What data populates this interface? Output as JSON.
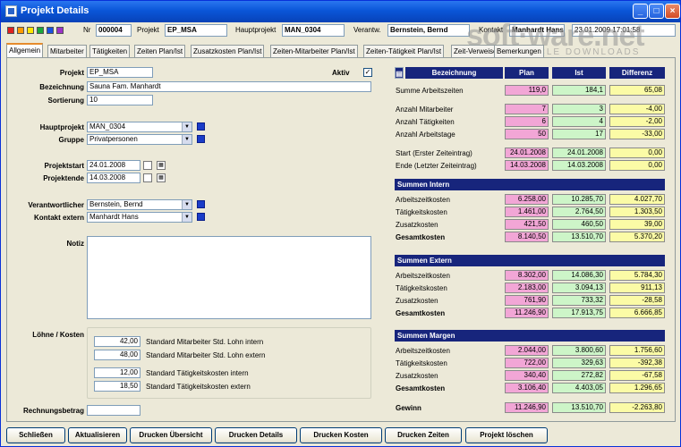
{
  "window": {
    "title": "Projekt Details"
  },
  "header": {
    "nr_label": "Nr",
    "nr_value": "000004",
    "projekt_label": "Projekt",
    "projekt_value": "EP_MSA",
    "hauptprojekt_label": "Hauptprojekt",
    "hauptprojekt_value": "MAN_0304",
    "verantw_label": "Verantw.",
    "verantw_value": "Bernstein, Bernd",
    "kontakt_label": "Kontakt",
    "kontakt_value": "Manhardt Hans",
    "date_value": "23.01.2009 17:01:58",
    "color_squares": [
      "#e02020",
      "#ff9a00",
      "#ffe600",
      "#1aa83a",
      "#1a50e0",
      "#9b32c8"
    ]
  },
  "tabs": [
    "Allgemein",
    "Mitarbeiter",
    "Tätigkeiten",
    "Zeiten Plan/Ist",
    "Zusatzkosten Plan/Ist",
    "Zeiten-Mitarbeiter Plan/Ist",
    "Zeiten-Tätigkeit Plan/Ist",
    "Zeit-Verweise",
    "Bemerkungen"
  ],
  "form": {
    "projekt_label": "Projekt",
    "projekt": "EP_MSA",
    "aktiv_label": "Aktiv",
    "aktiv_checked": "✓",
    "bezeichnung_label": "Bezeichnung",
    "bezeichnung": "Sauna Fam. Manhardt",
    "sortierung_label": "Sortierung",
    "sortierung": "10",
    "hauptprojekt_label": "Hauptprojekt",
    "hauptprojekt": "MAN_0304",
    "gruppe_label": "Gruppe",
    "gruppe": "Privatpersonen",
    "projektstart_label": "Projektstart",
    "projektstart": "24.01.2008",
    "projektende_label": "Projektende",
    "projektende": "14.03.2008",
    "verantwortlicher_label": "Verantwortlicher",
    "verantwortlicher": "Bernstein, Bernd",
    "kontakt_extern_label": "Kontakt extern",
    "kontakt_extern": "Manhardt Hans",
    "notiz_label": "Notiz",
    "loehne_label": "Löhne / Kosten",
    "rates": [
      {
        "value": "42,00",
        "label": "Standard Mitarbeiter Std. Lohn intern"
      },
      {
        "value": "48,00",
        "label": "Standard Mitarbeiter Std. Lohn extern"
      },
      {
        "value": "12,00",
        "label": "Standard Tätigkeitskosten intern"
      },
      {
        "value": "18,50",
        "label": "Standard Tätigkeitskosten extern"
      }
    ],
    "rechnungsbetrag_label": "Rechnungsbetrag",
    "rechnungsbetrag": ""
  },
  "summary": {
    "headers": {
      "bezeichnung": "Bezeichnung",
      "plan": "Plan",
      "ist": "Ist",
      "differenz": "Differenz"
    },
    "top_rows": [
      {
        "label": "Summe Arbeitszeiten",
        "plan": "119,0",
        "ist": "184,1",
        "diff": "65,08"
      },
      {
        "label": "Anzahl Mitarbeiter",
        "plan": "7",
        "ist": "3",
        "diff": "-4,00"
      },
      {
        "label": "Anzahl Tätigkeiten",
        "plan": "6",
        "ist": "4",
        "diff": "-2,00"
      },
      {
        "label": "Anzahl Arbeitstage",
        "plan": "50",
        "ist": "17",
        "diff": "-33,00"
      },
      {
        "label": "Start (Erster Zeiteintrag)",
        "plan": "24.01.2008",
        "ist": "24.01.2008",
        "diff": "0,00"
      },
      {
        "label": "Ende (Letzter Zeiteintrag)",
        "plan": "14.03.2008",
        "ist": "14.03.2008",
        "diff": "0,00"
      }
    ],
    "sections": [
      {
        "title": "Summen Intern",
        "rows": [
          {
            "label": "Arbeitszeitkosten",
            "plan": "6.258,00",
            "ist": "10.285,70",
            "diff": "4.027,70"
          },
          {
            "label": "Tätigkeitskosten",
            "plan": "1.461,00",
            "ist": "2.764,50",
            "diff": "1.303,50"
          },
          {
            "label": "Zusatzkosten",
            "plan": "421,50",
            "ist": "460,50",
            "diff": "39,00"
          },
          {
            "label": "Gesamtkosten",
            "plan": "8.140,50",
            "ist": "13.510,70",
            "diff": "5.370,20"
          }
        ]
      },
      {
        "title": "Summen Extern",
        "rows": [
          {
            "label": "Arbeitszeitkosten",
            "plan": "8.302,00",
            "ist": "14.086,30",
            "diff": "5.784,30"
          },
          {
            "label": "Tätigkeitskosten",
            "plan": "2.183,00",
            "ist": "3.094,13",
            "diff": "911,13"
          },
          {
            "label": "Zusatzkosten",
            "plan": "761,90",
            "ist": "733,32",
            "diff": "-28,58"
          },
          {
            "label": "Gesamtkosten",
            "plan": "11.246,90",
            "ist": "17.913,75",
            "diff": "6.666,85"
          }
        ]
      },
      {
        "title": "Summen Margen",
        "rows": [
          {
            "label": "Arbeitszeitkosten",
            "plan": "2.044,00",
            "ist": "3.800,60",
            "diff": "1.756,60"
          },
          {
            "label": "Tätigkeitskosten",
            "plan": "722,00",
            "ist": "329,63",
            "diff": "-392,38"
          },
          {
            "label": "Zusatzkosten",
            "plan": "340,40",
            "ist": "272,82",
            "diff": "-67,58"
          },
          {
            "label": "Gesamtkosten",
            "plan": "3.106,40",
            "ist": "4.403,05",
            "diff": "1.296,65"
          }
        ]
      }
    ],
    "gewinn": {
      "label": "Gewinn",
      "plan": "11.246,90",
      "ist": "13.510,70",
      "diff": "-2.263,80"
    }
  },
  "buttons": [
    "Schließen",
    "Aktualisieren",
    "Drucken Übersicht",
    "Drucken Details",
    "Drucken Kosten",
    "Drucken Zeiten",
    "Projekt löschen"
  ],
  "watermark": {
    "main": "soft·ware.net",
    "sub": "ARTICLE DOWNLOADS"
  }
}
